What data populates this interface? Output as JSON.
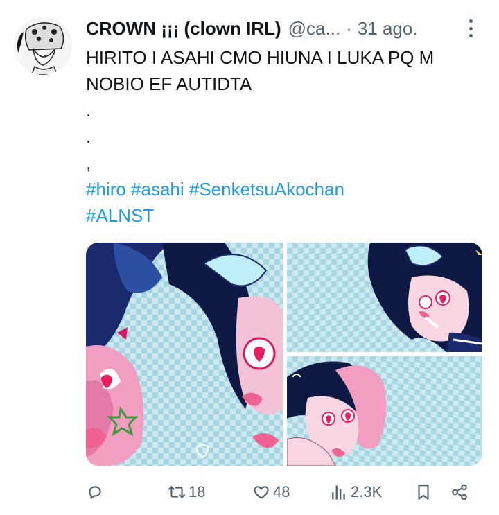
{
  "author": {
    "display_name": "CROWN ¡¡¡ (clown IRL)",
    "handle": "@ca...",
    "separator": "·",
    "date": "31 ago."
  },
  "tweet": {
    "lines": [
      "HIRITO I ASAHI CMO HIUNA I LUKA PQ M",
      "NOBIO EF AUTIDTA",
      ".",
      ".",
      ","
    ],
    "hashtags_line1": "#hiro #asahi #SenketsuAkochan",
    "hashtags_line2": "#ALNST"
  },
  "actions": {
    "reply_icon": "reply-icon",
    "retweet_icon": "retweet-icon",
    "retweet_count": "18",
    "like_icon": "heart-icon",
    "like_count": "48",
    "views_icon": "views-icon",
    "views_count": "2.3K",
    "bookmark_icon": "bookmark-icon",
    "share_icon": "share-icon"
  },
  "colors": {
    "text": "#0f1419",
    "secondary": "#536471",
    "link": "#1d9bf0",
    "checker_light": "#cde9f0",
    "checker_dark": "#a8d7e4"
  }
}
